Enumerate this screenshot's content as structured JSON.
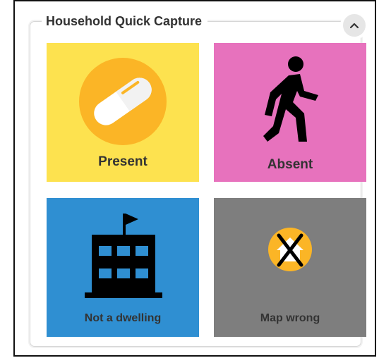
{
  "panel": {
    "title": "Household Quick Capture",
    "collapse_icon": "chevron-up-icon"
  },
  "tiles": [
    {
      "label": "Present",
      "color": "#fde24f",
      "icon": "pill-capsule-icon"
    },
    {
      "label": "Absent",
      "color": "#e772bd",
      "icon": "walking-person-icon"
    },
    {
      "label": "Not a dwelling",
      "color": "#2f8fd2",
      "icon": "building-flag-icon"
    },
    {
      "label": "Map wrong",
      "color": "#7e7e7e",
      "icon": "house-crossed-icon"
    }
  ]
}
